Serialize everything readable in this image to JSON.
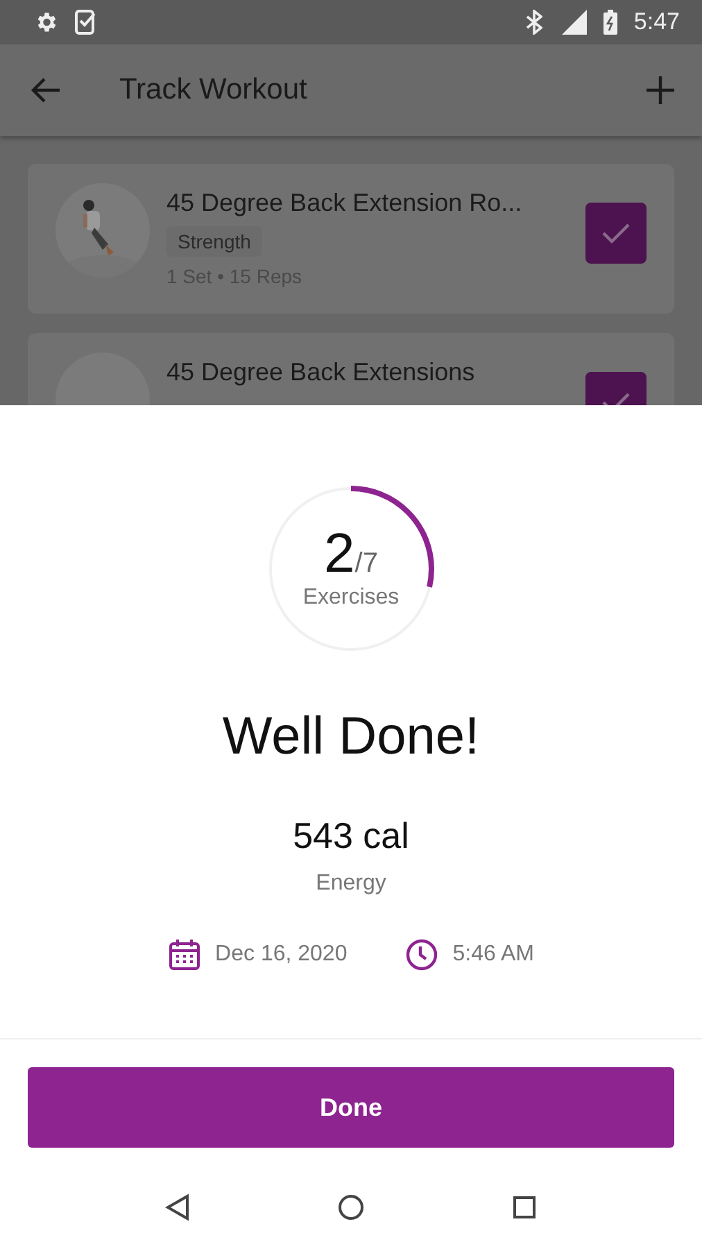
{
  "status_bar": {
    "time": "5:47"
  },
  "app_bar": {
    "title": "Track Workout"
  },
  "exercises": [
    {
      "name": "45 Degree Back Extension Ro...",
      "tag": "Strength",
      "detail": "1 Set • 15 Reps",
      "checked": true
    },
    {
      "name": "45 Degree Back Extensions",
      "checked": true
    }
  ],
  "summary": {
    "done": "2",
    "total": "/7",
    "unit": "Exercises",
    "level": 0.2857,
    "headline": "Well Done!",
    "energy": "543 cal",
    "energy_label": "Energy",
    "date": "Dec 16, 2020",
    "time": "5:46 AM"
  },
  "buttons": [
    "Done"
  ]
}
